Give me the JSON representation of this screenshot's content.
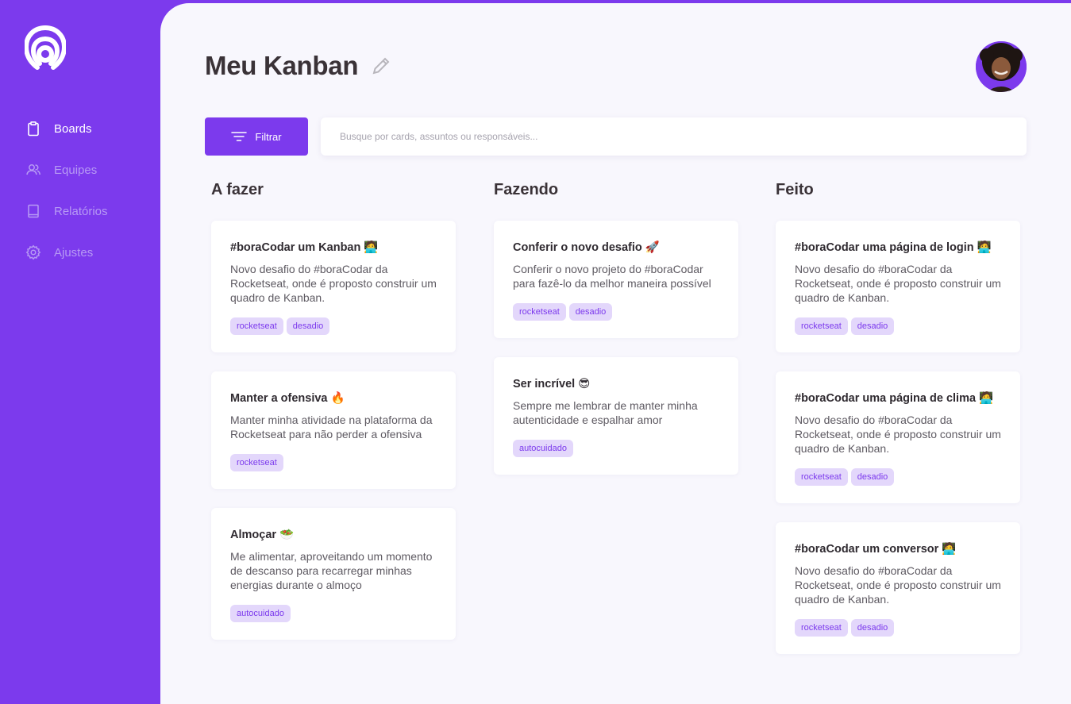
{
  "sidebar": {
    "items": [
      {
        "label": "Boards",
        "icon": "clipboard-icon",
        "active": true
      },
      {
        "label": "Equipes",
        "icon": "users-icon",
        "active": false
      },
      {
        "label": "Relatórios",
        "icon": "book-icon",
        "active": false
      },
      {
        "label": "Ajustes",
        "icon": "gear-icon",
        "active": false
      }
    ]
  },
  "header": {
    "title": "Meu Kanban"
  },
  "toolbar": {
    "filter_label": "Filtrar",
    "search_placeholder": "Busque por cards, assuntos ou responsáveis..."
  },
  "columns": [
    {
      "title": "A fazer",
      "cards": [
        {
          "title": "#boraCodar um Kanban 🧑‍💻",
          "desc": "Novo desafio do #boraCodar da Rocketseat, onde é proposto construir um quadro de Kanban.",
          "tags": [
            "rocketseat",
            "desadio"
          ]
        },
        {
          "title": "Manter a ofensiva 🔥",
          "desc": "Manter minha atividade na plataforma da Rocketseat para não perder a ofensiva",
          "tags": [
            "rocketseat"
          ]
        },
        {
          "title": "Almoçar 🥗",
          "desc": "Me alimentar, aproveitando um momento de descanso para recarregar minhas energias durante o almoço",
          "tags": [
            "autocuidado"
          ]
        }
      ]
    },
    {
      "title": "Fazendo",
      "cards": [
        {
          "title": "Conferir o novo desafio 🚀",
          "desc": "Conferir o novo projeto do #boraCodar para fazê-lo da melhor maneira possível",
          "tags": [
            "rocketseat",
            "desadio"
          ]
        },
        {
          "title": "Ser incrível 😎",
          "desc": "Sempre me lembrar de manter minha autenticidade e espalhar amor",
          "tags": [
            "autocuidado"
          ]
        }
      ]
    },
    {
      "title": "Feito",
      "cards": [
        {
          "title": "#boraCodar uma página de login 🧑‍💻",
          "desc": "Novo desafio do #boraCodar da Rocketseat, onde é proposto construir um quadro de Kanban.",
          "tags": [
            "rocketseat",
            "desadio"
          ]
        },
        {
          "title": "#boraCodar uma página de clima 🧑‍💻",
          "desc": "Novo desafio do #boraCodar da Rocketseat, onde é proposto construir um quadro de Kanban.",
          "tags": [
            "rocketseat",
            "desadio"
          ]
        },
        {
          "title": "#boraCodar um conversor 🧑‍💻",
          "desc": "Novo desafio do #boraCodar da Rocketseat, onde é proposto construir um quadro de Kanban.",
          "tags": [
            "rocketseat",
            "desadio"
          ]
        }
      ]
    }
  ],
  "colors": {
    "accent": "#7C3AED",
    "tag_bg": "#E3D7FB",
    "background": "#F8F7FD"
  }
}
